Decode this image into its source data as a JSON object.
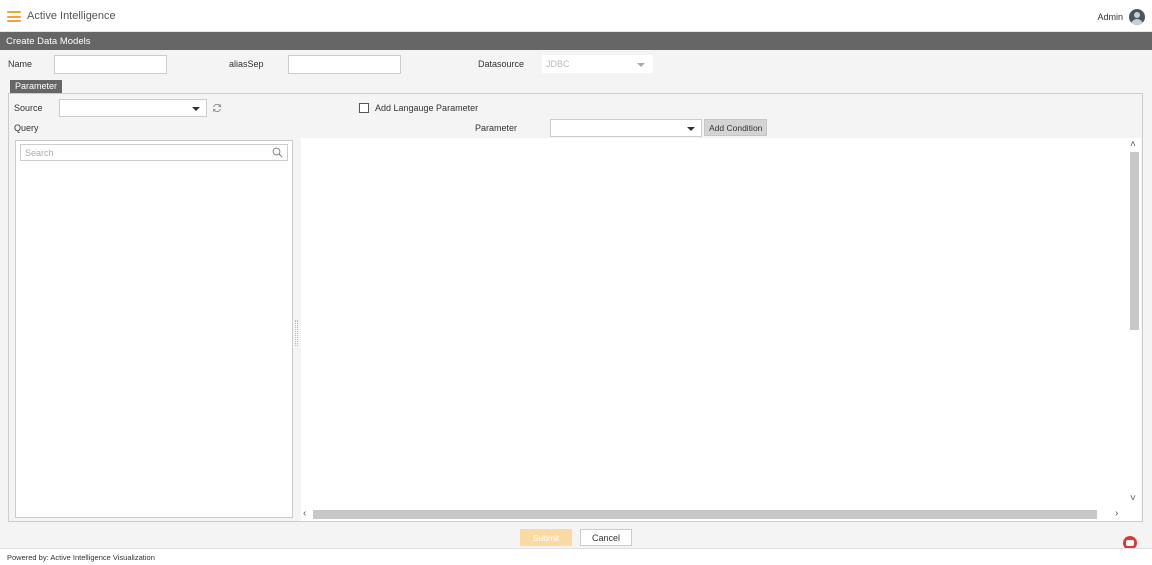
{
  "header": {
    "app_title": "Active Intelligence",
    "user_name": "Admin",
    "accent_color": "#f0a33a"
  },
  "page_title": "Create Data Models",
  "form": {
    "name_label": "Name",
    "name_value": "",
    "alias_sep_label": "aliasSep",
    "alias_sep_value": "",
    "datasource_label": "Datasource",
    "datasource_value": "JDBC"
  },
  "tabs": [
    {
      "label": "Parameter",
      "active": true
    }
  ],
  "parameter_panel": {
    "source_label": "Source",
    "source_value": "",
    "add_language_label": "Add Langauge Parameter",
    "add_language_checked": false,
    "query_label": "Query",
    "parameter_label": "Parameter",
    "parameter_value": "",
    "add_condition_label": "Add Condition",
    "search_placeholder": "Search"
  },
  "actions": {
    "submit_label": "Submit",
    "cancel_label": "Cancel"
  },
  "footer": {
    "powered_by": "Powered by: Active Intelligence Visualization"
  },
  "icons": [
    "hamburger-icon",
    "avatar",
    "dropdown-caret-icon",
    "refresh-icon",
    "search-icon",
    "chat-icon"
  ]
}
